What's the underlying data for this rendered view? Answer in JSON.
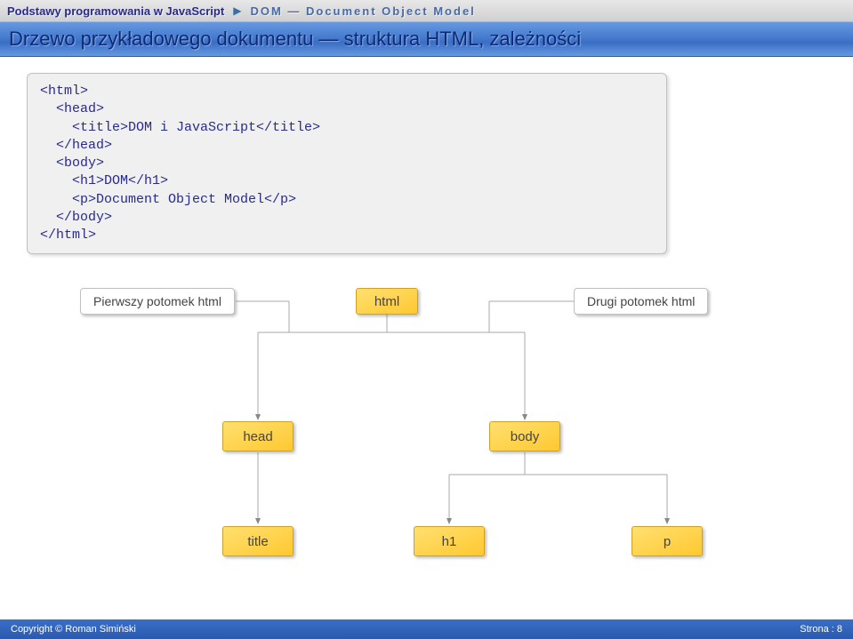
{
  "header": {
    "left": "Podstawy programowania w JavaScript",
    "right": "DOM — Document Object Model"
  },
  "subheader": "Drzewo przykładowego dokumentu — struktura HTML, zależności",
  "code_lines": [
    "<html>",
    "  <head>",
    "    <title>DOM i JavaScript</title>",
    "  </head>",
    "  <body>",
    "    <h1>DOM</h1>",
    "    <p>Document Object Model</p>",
    "  </body>",
    "</html>"
  ],
  "diagram": {
    "annotation_left": "Pierwszy potomek html",
    "annotation_right": "Drugi potomek html",
    "nodes": {
      "html": "html",
      "head": "head",
      "body": "body",
      "title": "title",
      "h1": "h1",
      "p": "p"
    }
  },
  "footer": {
    "copyright": "Copyright © Roman Simiński",
    "page_label": "Strona :",
    "page_num": "8"
  }
}
